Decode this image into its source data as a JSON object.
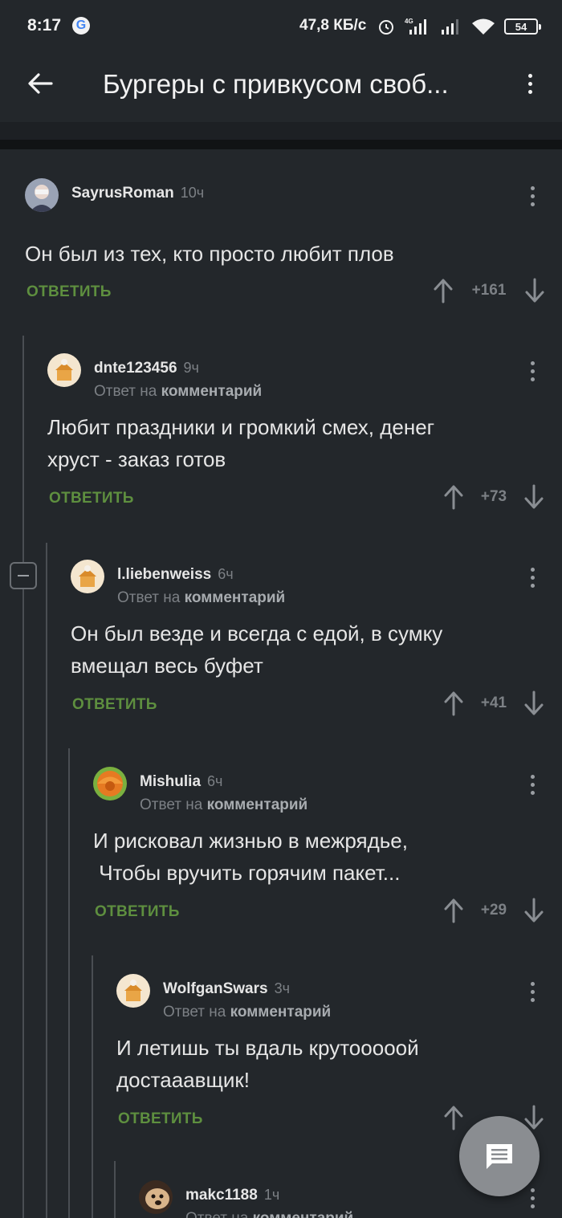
{
  "status_bar": {
    "time": "8:17",
    "speed": "47,8 КБ/с",
    "battery": "54",
    "network": "4G"
  },
  "app_bar": {
    "title": "Бургеры с привкусом своб..."
  },
  "comments": [
    {
      "user": "SayrusRoman",
      "time": "10ч",
      "reply_to_prefix": "",
      "reply_to_link": "",
      "text": "Он был из тех, кто просто любит плов",
      "reply_label": "ОТВЕТИТЬ",
      "score": "+161"
    },
    {
      "user": "dnte123456",
      "time": "9ч",
      "reply_to_prefix": "Ответ на",
      "reply_to_link": "комментарий",
      "text": "Любит праздники и громкий смех, денег\nхруст - заказ готов",
      "reply_label": "ОТВЕТИТЬ",
      "score": "+73"
    },
    {
      "user": "l.liebenweiss",
      "time": "6ч",
      "reply_to_prefix": "Ответ на",
      "reply_to_link": "комментарий",
      "text": "Он был везде и всегда с едой, в сумку\nвмещал весь буфет",
      "reply_label": "ОТВЕТИТЬ",
      "score": "+41"
    },
    {
      "user": "Mishulia",
      "time": "6ч",
      "reply_to_prefix": "Ответ на",
      "reply_to_link": "комментарий",
      "text": "И рисковал жизнью в межрядье,\n Чтобы вручить горячим пакет...",
      "reply_label": "ОТВЕТИТЬ",
      "score": "+29"
    },
    {
      "user": "WolfganSwars",
      "time": "3ч",
      "reply_to_prefix": "Ответ на",
      "reply_to_link": "комментарий",
      "text": "И летишь ты вдаль крутооооой\nдостаaавщик!",
      "reply_label": "ОТВЕТИТЬ",
      "score": ""
    },
    {
      "user": "makc1188",
      "time": "1ч",
      "reply_to_prefix": "Ответ на",
      "reply_to_link": "комментарий",
      "text": "",
      "reply_label": "",
      "score": ""
    }
  ],
  "colors": {
    "background": "#23272b",
    "reply_green": "#5e8f3f",
    "muted": "#7c8085"
  }
}
